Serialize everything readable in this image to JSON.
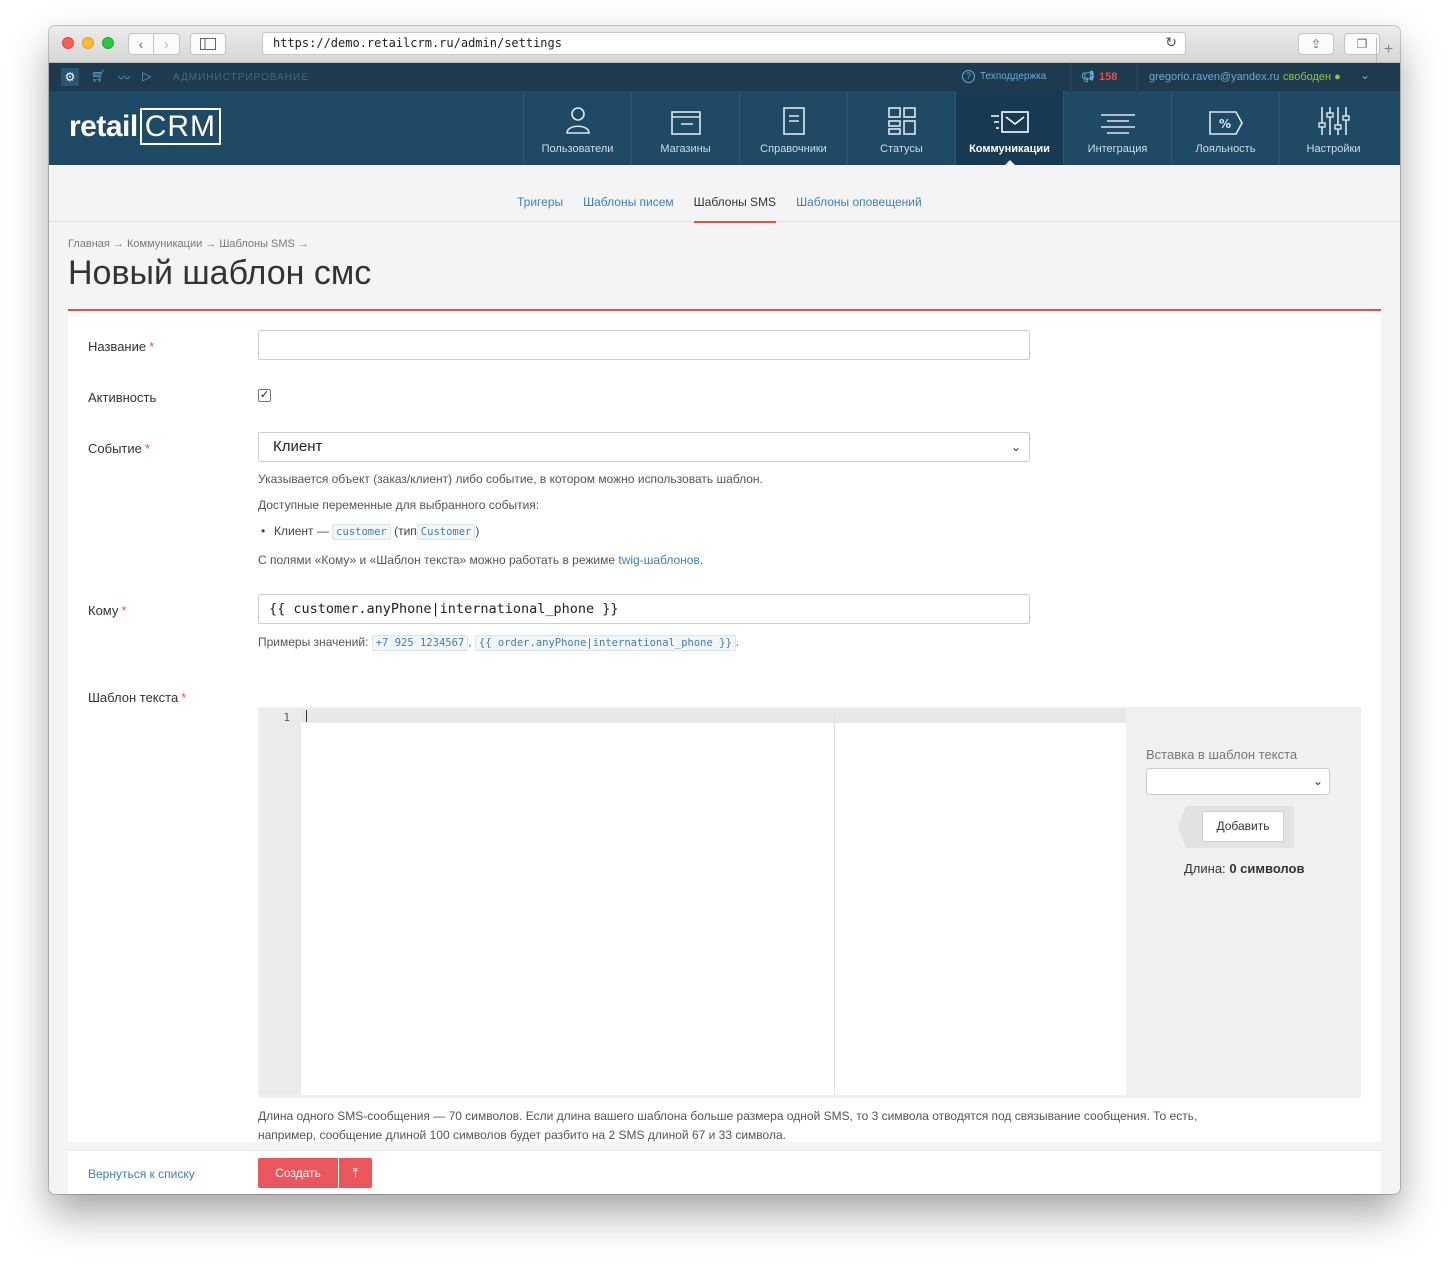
{
  "browser": {
    "url": "https://demo.retailcrm.ru/admin/settings"
  },
  "topbar": {
    "section_label": "АДМИНИСТРИРОВАНИЕ",
    "support": "Техподдержка",
    "notifications_count": "158",
    "user_email": "gregorio.raven@yandex.ru",
    "user_status": "свободен"
  },
  "header": {
    "logo_text": "retail",
    "logo_crm": "CRM",
    "nav": [
      {
        "label": "Пользователи",
        "icon": "user-icon"
      },
      {
        "label": "Магазины",
        "icon": "store-icon"
      },
      {
        "label": "Справочники",
        "icon": "document-icon"
      },
      {
        "label": "Статусы",
        "icon": "grid-icon"
      },
      {
        "label": "Коммуникации",
        "icon": "mail-icon",
        "active": true
      },
      {
        "label": "Интеграция",
        "icon": "integration-icon"
      },
      {
        "label": "Лояльность",
        "icon": "percent-tag-icon"
      },
      {
        "label": "Настройки",
        "icon": "sliders-icon"
      }
    ]
  },
  "subnav": {
    "tabs": [
      {
        "label": "Тригеры"
      },
      {
        "label": "Шаблоны писем"
      },
      {
        "label": "Шаблоны SMS",
        "active": true
      },
      {
        "label": "Шаблоны оповещений"
      }
    ]
  },
  "breadcrumbs": "Главная → Коммуникации → Шаблоны SMS →",
  "page_title": "Новый шаблон смс",
  "form": {
    "name_label": "Название",
    "name_value": "",
    "active_label": "Активность",
    "active_checked": true,
    "event_label": "Событие",
    "event_value": "Клиент",
    "event_help": "Указывается объект (заказ/клиент) либо событие, в котором можно использовать шаблон.",
    "vars_help": "Доступные переменные для выбранного события:",
    "var_item_prefix": "Клиент —",
    "var_item_name": "customer",
    "var_item_type_prefix": "(тип",
    "var_item_type": "Customer",
    "var_item_suffix": ")",
    "twig_help_prefix": "С полями «Кому» и «Шаблон текста» можно работать в режиме",
    "twig_link": "twig-шаблонов",
    "twig_help_suffix": ".",
    "to_label": "Кому",
    "to_value": "{{ customer.anyPhone|international_phone }}",
    "to_examples_prefix": "Примеры значений:",
    "to_example_1": "+7 925 1234567",
    "to_example_2": "{{ order.anyPhone|international_phone }}",
    "text_label": "Шаблон текста",
    "editor_line": "1",
    "insert_label": "Вставка в шаблон текста",
    "insert_value": "",
    "add_button": "Добавить",
    "length_prefix": "Длина:",
    "length_value": "0 символов",
    "footnote": "Длина одного SMS-сообщения — 70 символов. Если длина вашего шаблона больше размера одной SMS, то 3 символа отводятся под связывание сообщения. То есть, например, сообщение длиной 100 символов будет разбито на 2 SMS длиной 67 и 33 символа."
  },
  "footer": {
    "back_link": "Вернуться к списку",
    "create_button": "Создать",
    "create_arrow": "⤒"
  }
}
